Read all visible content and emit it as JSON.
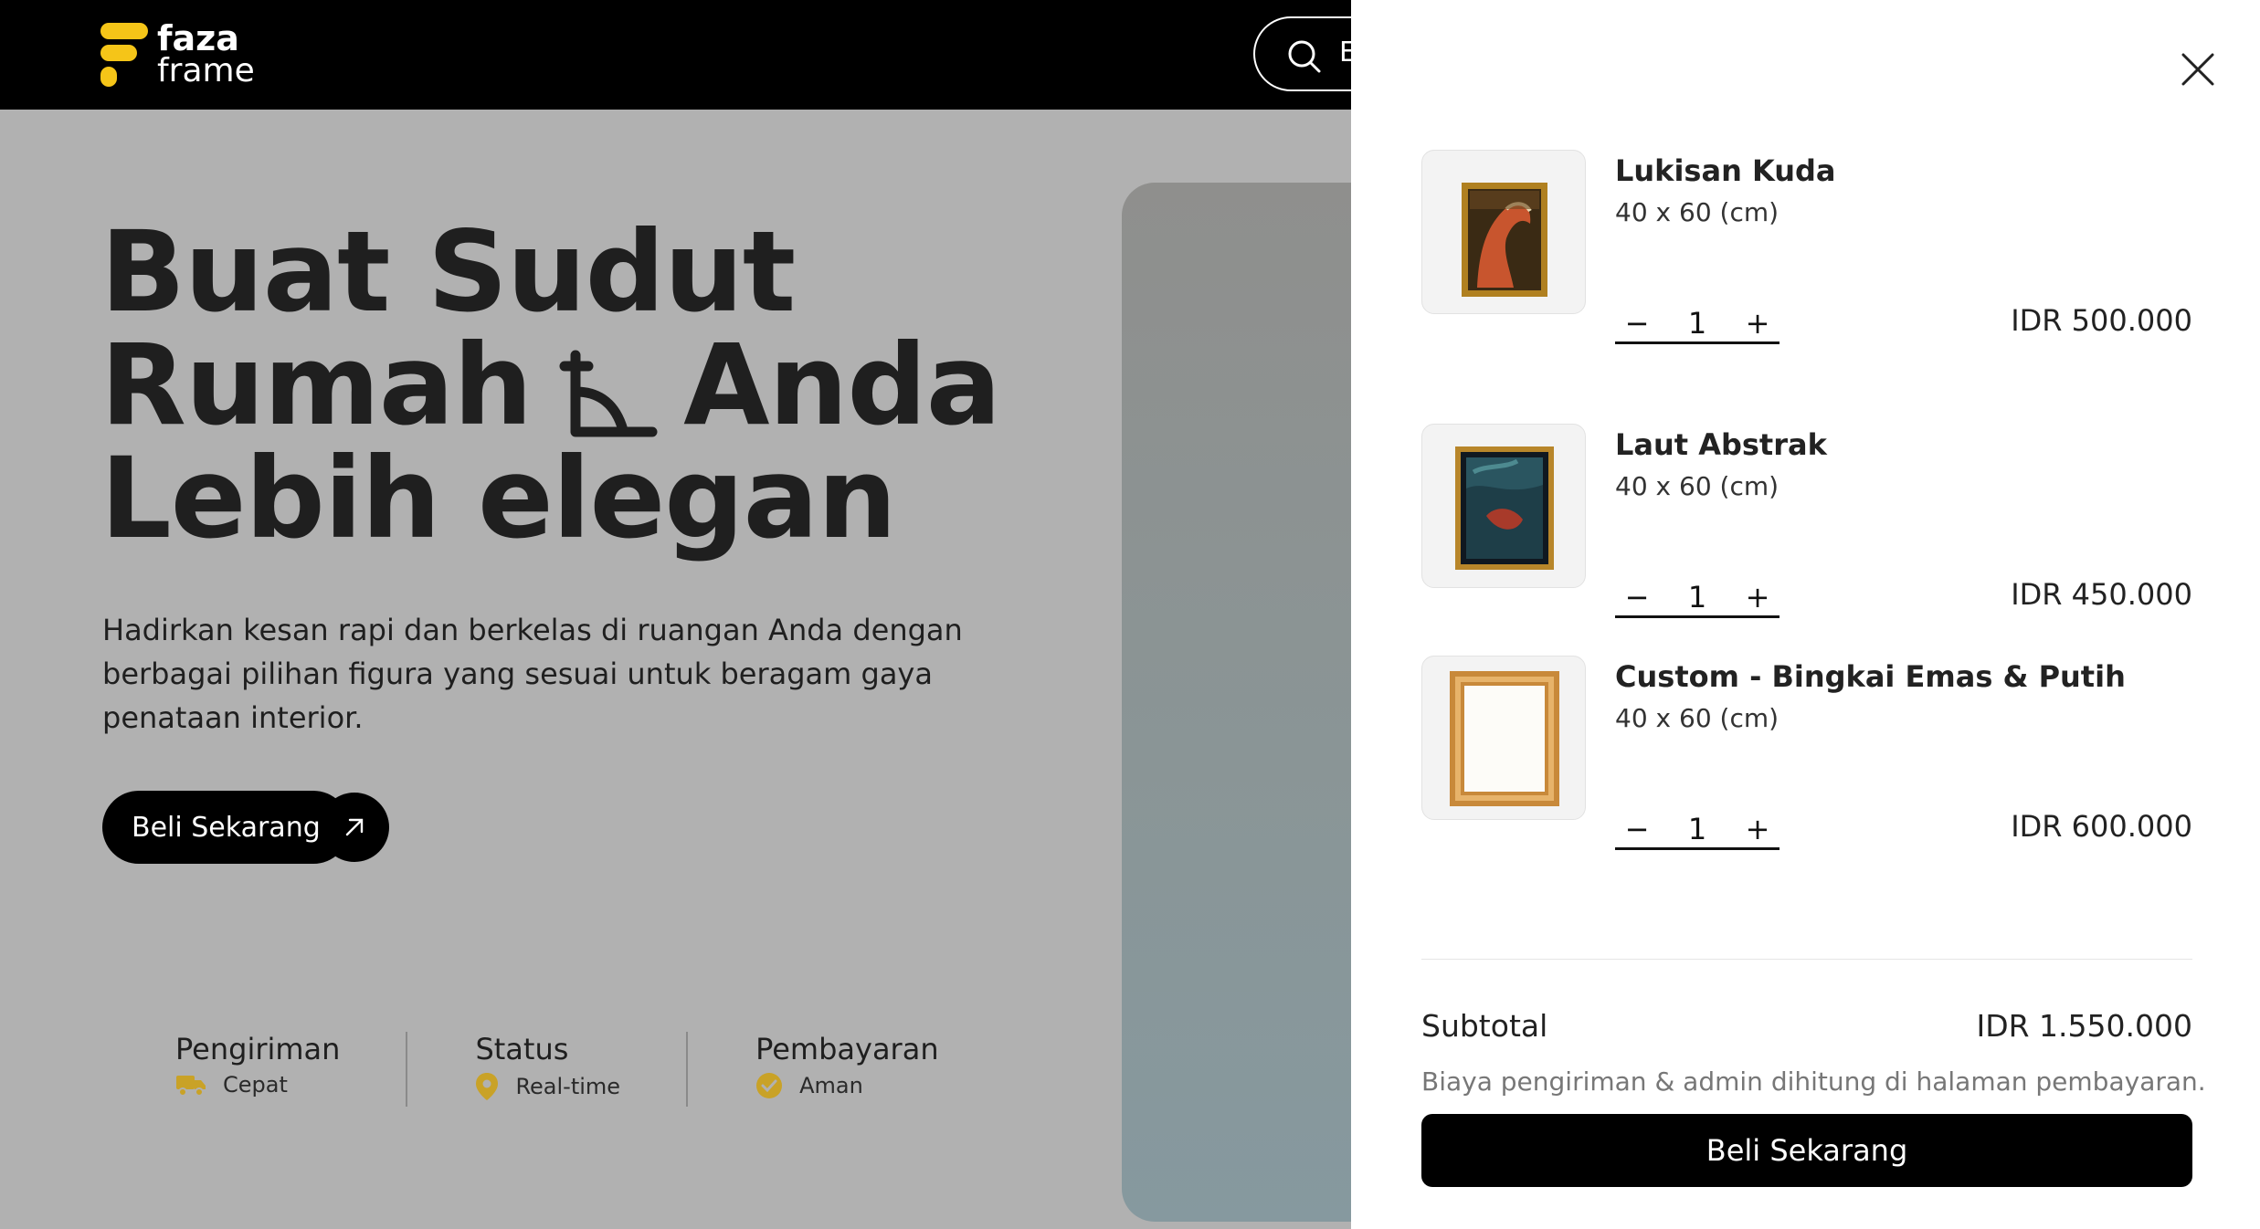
{
  "brand": {
    "name_line1": "faza",
    "name_line2": "frame",
    "accent": "#f5c518"
  },
  "search": {
    "placeholder_fragment": "E"
  },
  "hero": {
    "line1": "Buat Sudut",
    "line2_a": "Rumah",
    "line2_b": "Anda",
    "line3": "Lebih elegan",
    "description": "Hadirkan kesan rapi dan berkelas di ruangan Anda dengan berbagai pilihan figura yang sesuai untuk beragam gaya penataan interior.",
    "cta_label": "Beli Sekarang"
  },
  "features": [
    {
      "title": "Pengiriman",
      "value": "Cepat",
      "icon": "truck-icon"
    },
    {
      "title": "Status",
      "value": "Real-time",
      "icon": "location-pin-icon"
    },
    {
      "title": "Pembayaran",
      "value": "Aman",
      "icon": "check-circle-icon"
    }
  ],
  "cart": {
    "items": [
      {
        "name": "Lukisan Kuda",
        "size": "40 x 60 (cm)",
        "qty": "1",
        "price": "IDR 500.000"
      },
      {
        "name": "Laut Abstrak",
        "size": "40 x 60 (cm)",
        "qty": "1",
        "price": "IDR 450.000"
      },
      {
        "name": "Custom - Bingkai Emas & Putih",
        "size": "40 x 60 (cm)",
        "qty": "1",
        "price": "IDR 600.000"
      }
    ],
    "minus": "−",
    "plus": "+",
    "subtotal_label": "Subtotal",
    "subtotal_value": "IDR 1.550.000",
    "note": "Biaya pengiriman & admin dihitung di halaman pembayaran.",
    "checkout_label": "Beli Sekarang"
  }
}
